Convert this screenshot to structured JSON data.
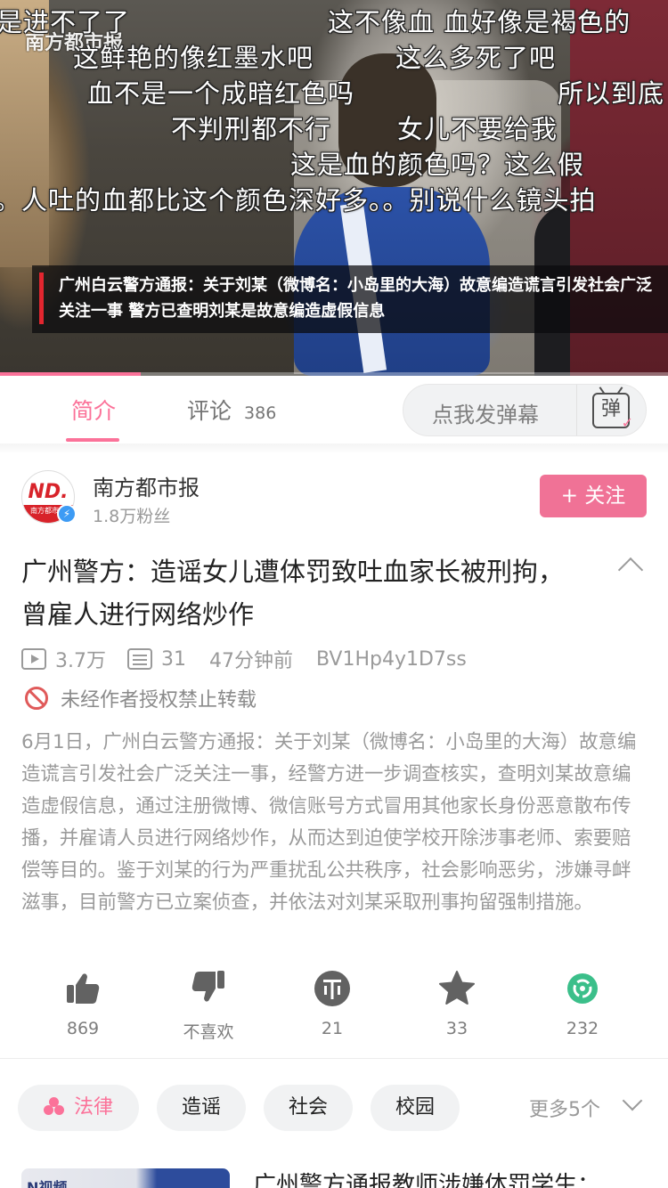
{
  "video": {
    "watermark": "南方都市报",
    "danmaku": [
      "是进不了了",
      "这不像血 血好像是褐色的",
      "这鲜艳的像红墨水吧",
      "这么多死了吧",
      "血不是一个成暗红色吗",
      "所以到底",
      "不判刑都不行",
      "女儿不要给我",
      "这是血的颜色吗？这么假",
      "。人吐的血都比这个颜色深好多。。别说什么镜头拍"
    ],
    "news_caption": "广州白云警方通报：关于刘某（微博名：小岛里的大海）故意编造谎言引发社会广泛关注一事 警方已查明刘某是故意编造虚假信息",
    "progress_fraction": 0.21
  },
  "tabs": {
    "intro_label": "简介",
    "comments_label": "评论",
    "comments_count": "386",
    "danmaku_placeholder": "点我发弹幕",
    "danmaku_icon_glyph": "弹"
  },
  "uploader": {
    "name": "南方都市报",
    "fans": "1.8万粉丝",
    "avatar_text": "ND.",
    "avatar_subtext": "南方都市报",
    "follow_label": "+ 关注"
  },
  "video_info": {
    "title": "广州警方：造谣女儿遭体罚致吐血家长被刑拘，曾雇人进行网络炒作",
    "views": "3.7万",
    "danmaku_count": "31",
    "time_ago": "47分钟前",
    "bvid": "BV1Hp4y1D7ss",
    "reprint_notice": "未经作者授权禁止转载",
    "description": "6月1日，广州白云警方通报：关于刘某（微博名：小岛里的大海）故意编造谎言引发社会广泛关注一事，经警方进一步调查核实，查明刘某故意编造虚假信息，通过注册微博、微信账号方式冒用其他家长身份恶意散布传播，并雇请人员进行网络炒作，从而达到迫使学校开除涉事老师、索要赔偿等目的。鉴于刘某的行为严重扰乱公共秩序，社会影响恶劣，涉嫌寻衅滋事，目前警方已立案侦查，并依法对刘某采取刑事拘留强制措施。"
  },
  "actions": {
    "like": "869",
    "dislike_label": "不喜欢",
    "coin": "21",
    "favorite": "33",
    "share": "232"
  },
  "tags": {
    "items": [
      "法律",
      "造谣",
      "社会",
      "校园"
    ],
    "more_label": "更多5个"
  },
  "related": {
    "first_title": "广州警方通报教师涉嫌体罚学生：",
    "thumb_text": "N视频"
  },
  "colors": {
    "accent": "#fb7299",
    "follow_bg": "#f07296",
    "news_bar": "#e2262f",
    "share_green": "#3bbf8a"
  }
}
